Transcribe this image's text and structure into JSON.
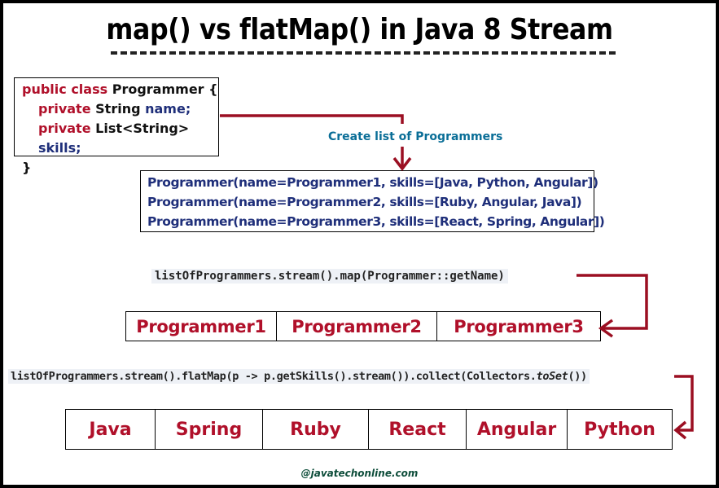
{
  "title": "map() vs flatMap() in Java 8 Stream",
  "class_definition": {
    "line1": {
      "keyword": "public class",
      "name": "Programmer {"
    },
    "line2": {
      "keyword": "private",
      "type": "String",
      "field": "name;"
    },
    "line3": {
      "keyword": "private",
      "type": "List<String>",
      "field": "skills;"
    },
    "line4": "}"
  },
  "create_label": "Create list of Programmers",
  "programmers_list": [
    "Programmer(name=Programmer1, skills=[Java, Python, Angular])",
    "Programmer(name=Programmer2, skills=[Ruby, Angular, Java])",
    "Programmer(name=Programmer3, skills=[React, Spring, Angular])"
  ],
  "map_code": "listOfProgrammers.stream().map(Programmer::getName)",
  "map_result": [
    "Programmer1",
    "Programmer2",
    "Programmer3"
  ],
  "flatmap_code": {
    "prefix": "listOfProgrammers.stream().flatMap(p -> p.getSkills().stream()).collect(Collectors.",
    "method": "toSet",
    "suffix": "())"
  },
  "flatmap_result": [
    "Java",
    "Spring",
    "Ruby",
    "React",
    "Angular",
    "Python"
  ],
  "watermark": "@javatechonline.com",
  "colors": {
    "arrow": "#9b0f22",
    "keyword": "#b0102a",
    "identifier": "#1f2f7a",
    "label": "#0a6e97"
  }
}
